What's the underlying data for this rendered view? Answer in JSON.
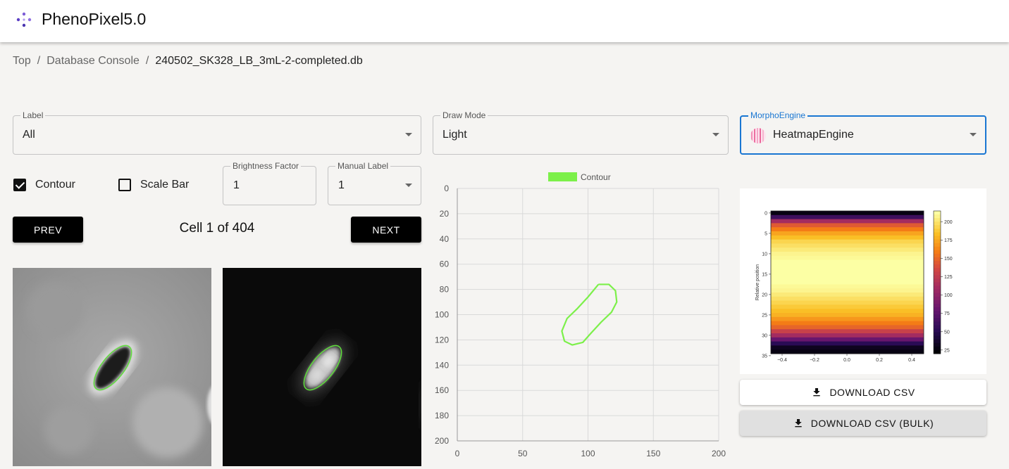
{
  "app": {
    "title": "PhenoPixel5.0",
    "logo_icon": "network-nodes-icon"
  },
  "breadcrumb": {
    "items": [
      "Top",
      "Database Console"
    ],
    "separator": "/",
    "current": "240502_SK328_LB_3mL-2-completed.db"
  },
  "controls": {
    "label_select": {
      "label": "Label",
      "value": "All"
    },
    "draw_mode": {
      "label": "Draw Mode",
      "value": "Light"
    },
    "engine": {
      "label": "MorphoEngine",
      "value": "HeatmapEngine",
      "icon": "heatmap-engine-icon"
    },
    "contour_checkbox": {
      "label": "Contour",
      "checked": true
    },
    "scalebar_checkbox": {
      "label": "Scale Bar",
      "checked": false
    },
    "brightness": {
      "label": "Brightness Factor",
      "value": "1"
    },
    "manual_label": {
      "label": "Manual Label",
      "value": "1"
    }
  },
  "nav": {
    "prev": "PREV",
    "next": "NEXT",
    "cell_status": "Cell 1 of 404"
  },
  "downloads": {
    "csv": "DOWNLOAD CSV",
    "csv_bulk": "DOWNLOAD CSV (BULK)",
    "icon": "download-icon"
  },
  "colors": {
    "accent": "#1976d2",
    "contour": "#7cf04a",
    "button": "#000000"
  },
  "chart_data": [
    {
      "type": "scatter",
      "legend": [
        "Contour"
      ],
      "legend_position": "top",
      "xlim": [
        0,
        200
      ],
      "ylim": [
        200,
        0
      ],
      "x_ticks": [
        0,
        50,
        100,
        150,
        200
      ],
      "y_ticks": [
        0,
        20,
        40,
        60,
        80,
        100,
        120,
        140,
        160,
        180,
        200
      ],
      "grid": true,
      "series": [
        {
          "name": "Contour",
          "color": "#7cf04a",
          "points": [
            [
              108,
              76
            ],
            [
              116,
              76
            ],
            [
              121,
              81
            ],
            [
              122,
              90
            ],
            [
              118,
              98
            ],
            [
              110,
              106
            ],
            [
              102,
              115
            ],
            [
              96,
              122
            ],
            [
              88,
              124
            ],
            [
              82,
              121
            ],
            [
              80,
              113
            ],
            [
              84,
              103
            ],
            [
              92,
              95
            ],
            [
              100,
              86
            ],
            [
              108,
              76
            ]
          ]
        }
      ]
    },
    {
      "type": "heatmap",
      "ylabel": "Relative position",
      "x_ticks": [
        "−0.4",
        "−0.2",
        "0.0",
        "0.2",
        "0.4"
      ],
      "y_ticks": [
        "0",
        "5",
        "10",
        "15",
        "20",
        "25",
        "30",
        "35"
      ],
      "colorbar_ticks": [
        "25",
        "50",
        "75",
        "100",
        "125",
        "150",
        "175",
        "200"
      ],
      "colormap": "inferno",
      "row_values": [
        25,
        60,
        110,
        145,
        160,
        175,
        185,
        195,
        200,
        205,
        210,
        212,
        215,
        218,
        220,
        220,
        218,
        215,
        212,
        210,
        205,
        200,
        195,
        190,
        185,
        180,
        170,
        160,
        150,
        130,
        110,
        80,
        50,
        30,
        25
      ]
    }
  ]
}
